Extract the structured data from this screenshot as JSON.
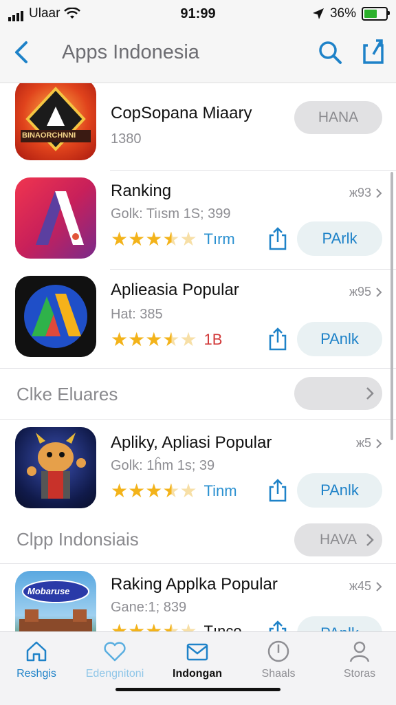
{
  "status": {
    "carrier": "Ulaar",
    "time": "91:99",
    "battery_text": "36%"
  },
  "nav": {
    "title": "Apps Indonesia"
  },
  "rows": [
    {
      "name": "CopSopana  Miaary",
      "sub": "1380",
      "button": "HANA",
      "icon_text": "BINAORCHNNI"
    },
    {
      "name": "Ranking",
      "sub": "Golk:  Tiısm 1S; 399",
      "rating_label": "Tırm",
      "rank": "ж93",
      "button": "PArlk",
      "stars": 3.5
    },
    {
      "name": "Aplieasia Popular",
      "sub": "Hat: 385",
      "rating_label": "1B",
      "rank": "ж95",
      "button": "PAnlk",
      "stars": 3.5
    },
    {
      "name": "Apliky, Apliasi Popular",
      "sub": "Golk: 1ĥm 1s; 39",
      "rating_label": "Tinm",
      "rank": "ж5",
      "button": "PAnlk",
      "stars": 3.5
    },
    {
      "name": "Raking  Applka Popular",
      "sub": "Gane:1;  839",
      "rating_label": "Tınco",
      "rank": "ж45",
      "button": "PAnlk",
      "stars": 3.5,
      "icon_text": "Mobaruse"
    }
  ],
  "sections": [
    {
      "title": "Clke Eluares"
    },
    {
      "title": "Clpp Indonsiais",
      "button": "HAVA"
    }
  ],
  "tabs": [
    {
      "label": "Reshgis",
      "icon": "home-icon"
    },
    {
      "label": "Edengnitoni",
      "icon": "heart-icon"
    },
    {
      "label": "Indongan",
      "icon": "mail-icon"
    },
    {
      "label": "Shaals",
      "icon": "clock-icon"
    },
    {
      "label": "Storas",
      "icon": "person-icon"
    }
  ],
  "colors": {
    "accent": "#1e82c8",
    "star": "#f3b31a",
    "red_label": "#d23a3a",
    "button_bg": "#e9f1f3"
  }
}
